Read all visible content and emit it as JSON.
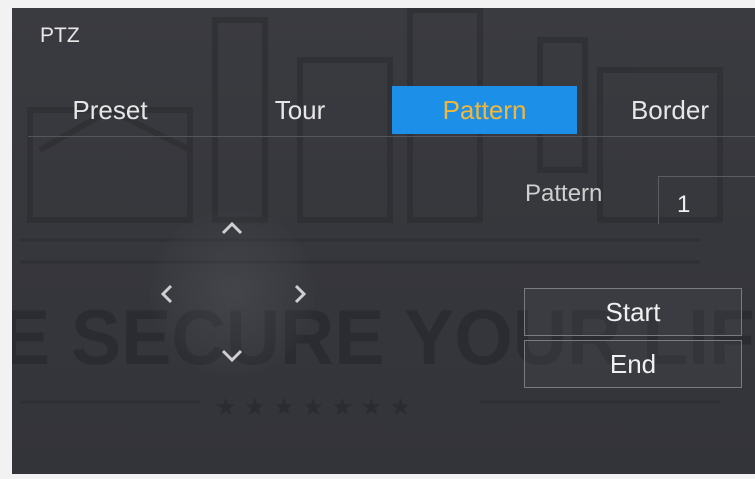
{
  "window": {
    "title": "PTZ"
  },
  "tabs": [
    {
      "label": "Preset",
      "active": false
    },
    {
      "label": "Tour",
      "active": false
    },
    {
      "label": "Pattern",
      "active": true
    },
    {
      "label": "Border",
      "active": false
    }
  ],
  "pattern_panel": {
    "field_label": "Pattern",
    "field_value": "1",
    "start_label": "Start",
    "end_label": "End"
  },
  "direction_pad": {
    "icons": [
      "arrow-up-icon",
      "arrow-left-icon",
      "arrow-right-icon",
      "arrow-down-icon"
    ]
  },
  "colors": {
    "active_tab_bg": "#1c8fe8",
    "active_tab_text": "#f2b73a",
    "panel_bg": "#36373c",
    "text": "#e6e6e6"
  },
  "watermark": {
    "text": "E SECURE YOUR LIF"
  }
}
